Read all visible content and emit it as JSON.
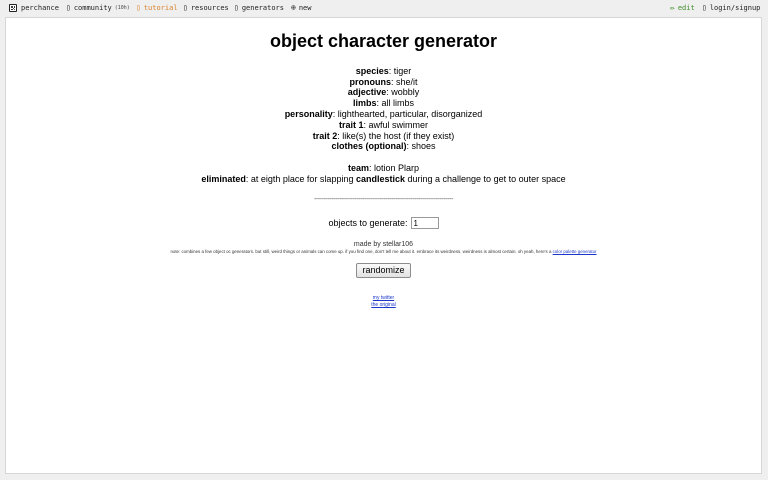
{
  "topbar": {
    "brand": "perchance",
    "community": "community",
    "community_count": "(10h)",
    "tutorial": "tutorial",
    "resources": "resources",
    "generators": "generators",
    "new": "new",
    "edit": "edit",
    "login": "login/signup"
  },
  "title": "object character generator",
  "fields": [
    {
      "label": "species",
      "value": ": tiger"
    },
    {
      "label": "pronouns",
      "value": ": she/it"
    },
    {
      "label": "adjective",
      "value": ": wobbly"
    },
    {
      "label": "limbs",
      "value": ": all limbs"
    },
    {
      "label": "personality",
      "value": ": lighthearted, particular, disorganized"
    },
    {
      "label": "trait 1",
      "value": ": awful swimmer"
    },
    {
      "label": "trait 2",
      "value": ": like(s) the host (if they exist)"
    },
    {
      "label": "clothes (optional)",
      "value": ": shoes"
    }
  ],
  "team": {
    "label": "team",
    "value": ": lotion Plarp"
  },
  "eliminated": {
    "label": "eliminated",
    "before": ": at eigth place for slapping ",
    "object": "candlestick",
    "after": " during a challenge to get to outer space"
  },
  "divider": "------------------------------------------------------------------------",
  "generate": {
    "label": "objects to generate:",
    "value": "1"
  },
  "made_by": "made by stellar106",
  "note": {
    "text": "note: combines a few object oc generators. but still, weird things or animals can come up. if you find one, don't tell me about it. embrace its weirdness. weirdness is almost certain. oh yeah, here's a ",
    "link": "color palette generator"
  },
  "randomize_label": "randomize",
  "links": {
    "twitter": "my twitter",
    "original": "the original"
  },
  "icons": {
    "brand": "die-icon",
    "community": "chat-icon",
    "tutorial": "book-icon",
    "resources": "resources-icon",
    "generators": "grid-icon",
    "new": "plus-circle-icon",
    "edit": "pencil-icon",
    "login": "person-icon"
  }
}
